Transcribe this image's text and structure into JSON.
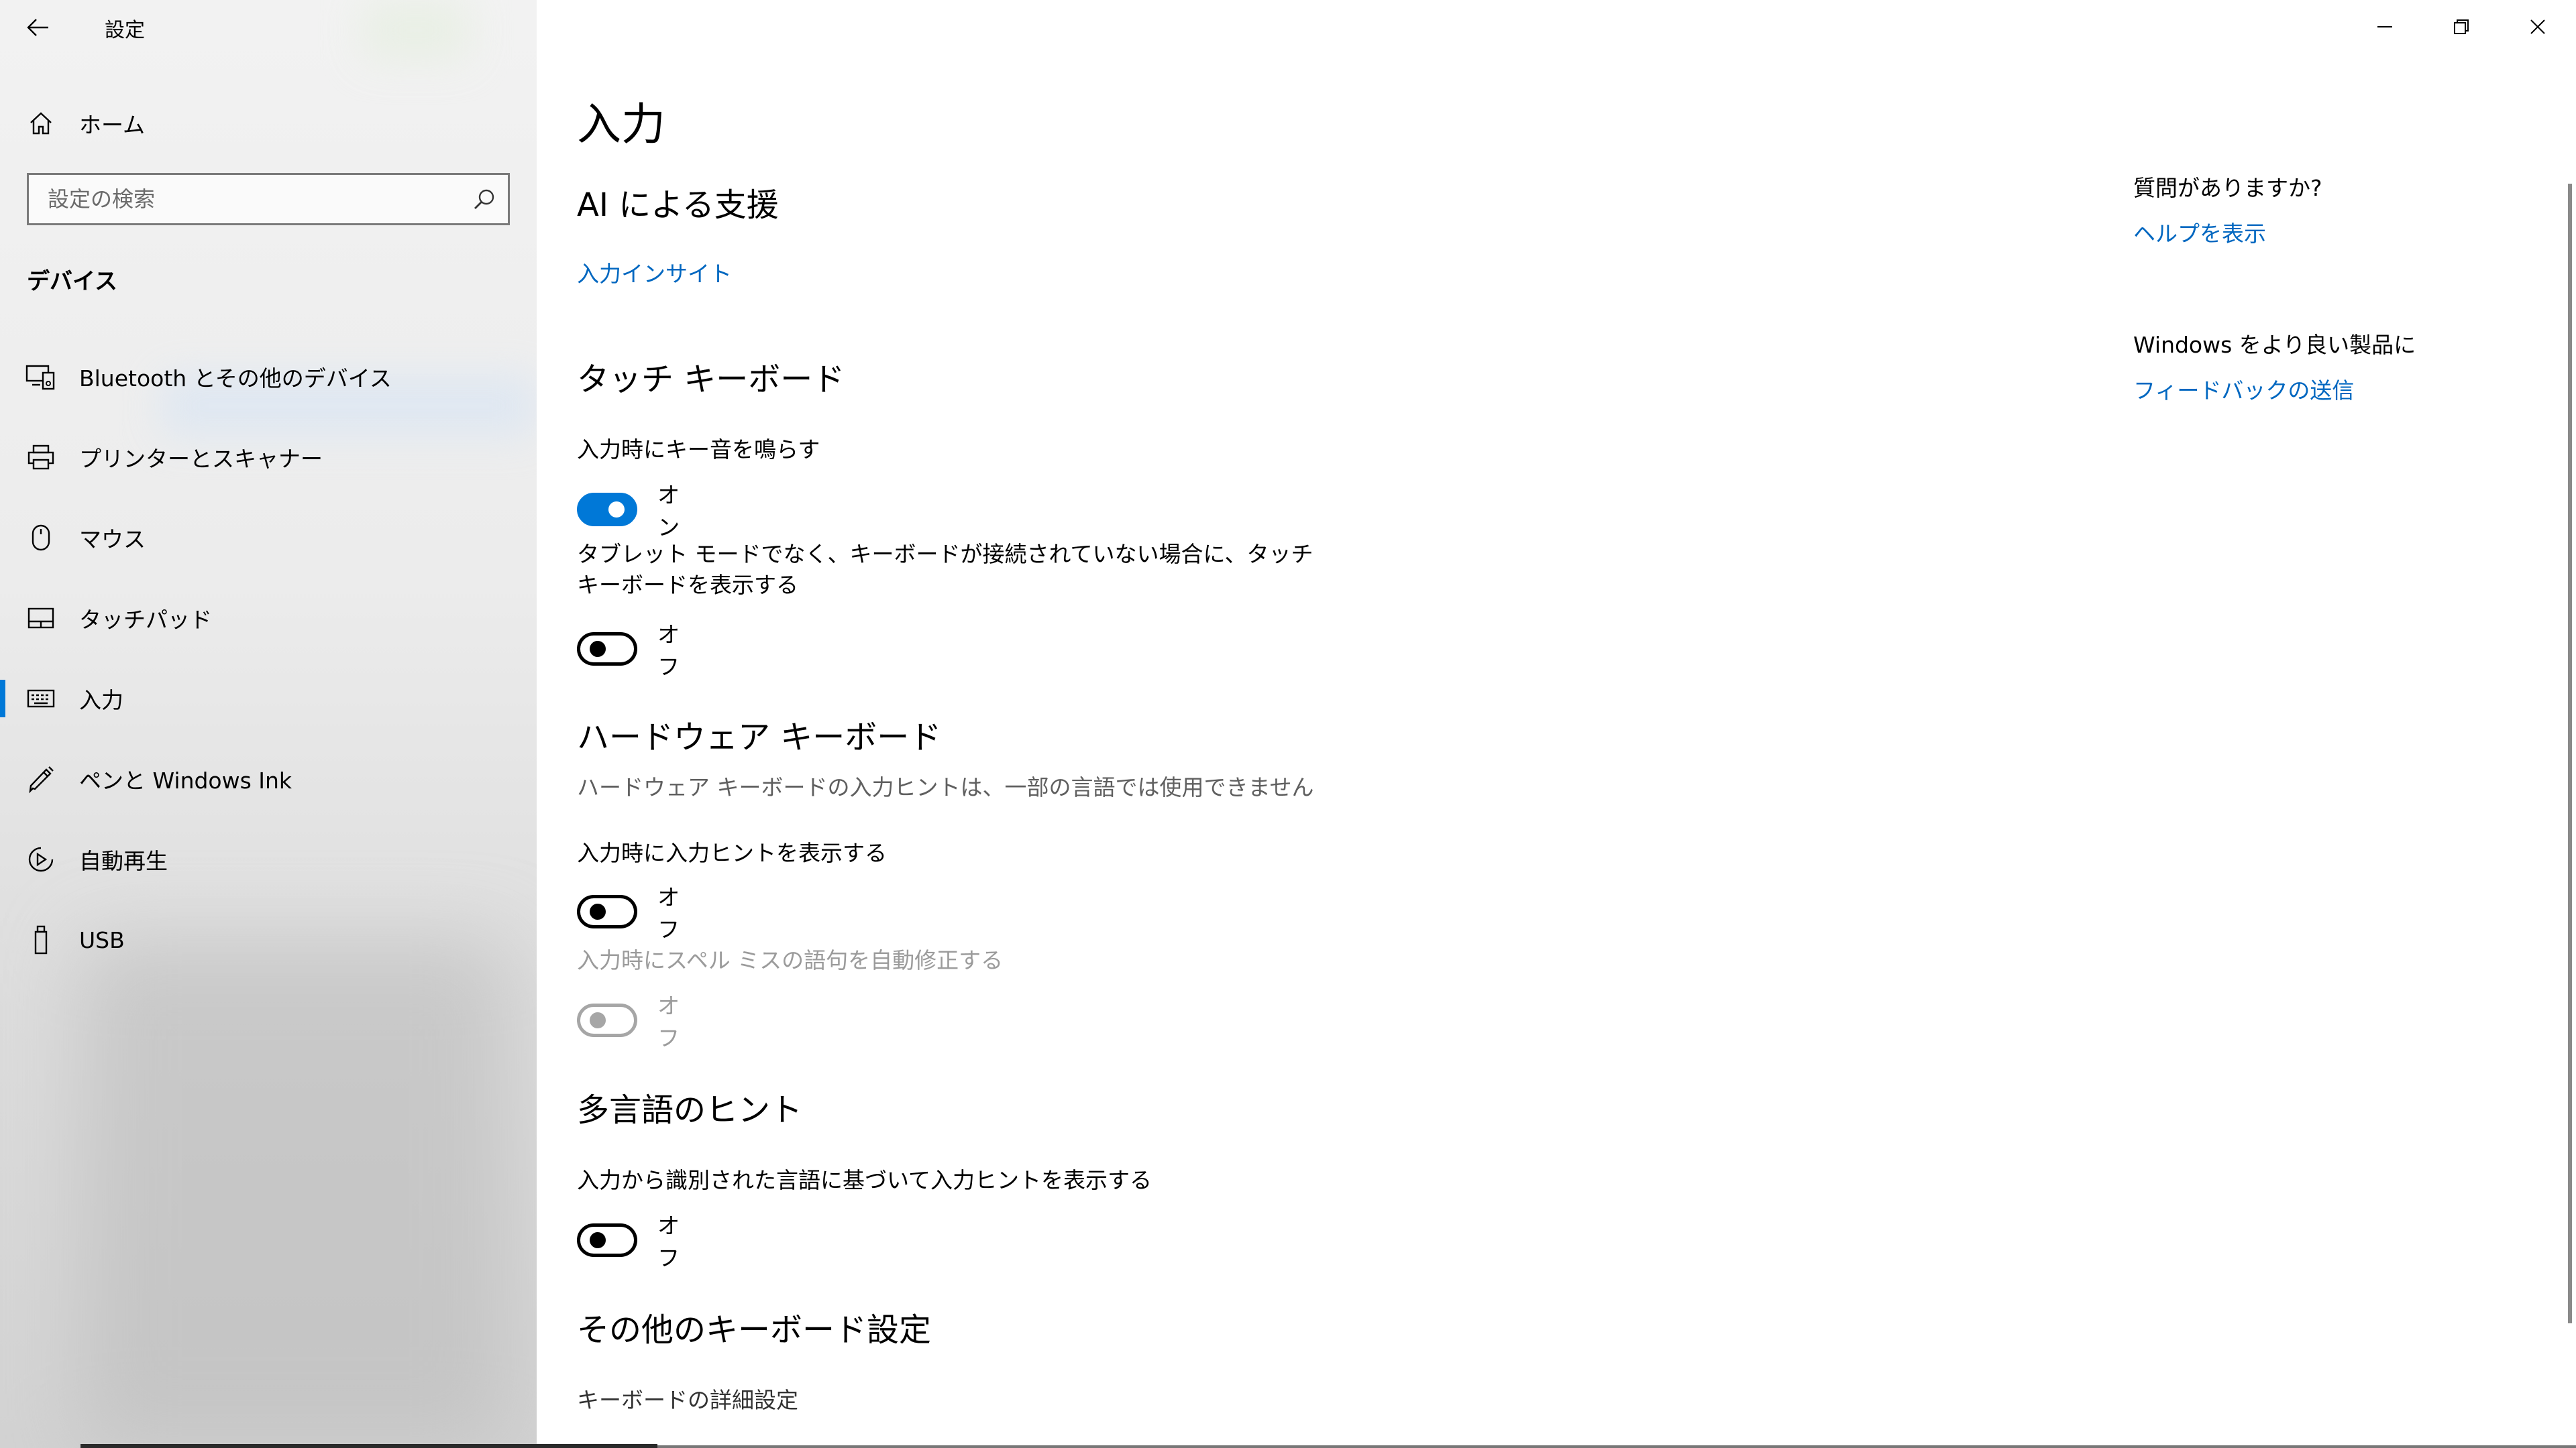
{
  "window": {
    "title": "設定",
    "controls": [
      "minimize",
      "restore",
      "close"
    ]
  },
  "sidebar": {
    "home_label": "ホーム",
    "search_placeholder": "設定の検索",
    "section": "デバイス",
    "items": [
      {
        "label": "Bluetooth とその他のデバイス",
        "icon": "devices-icon"
      },
      {
        "label": "プリンターとスキャナー",
        "icon": "printer-icon"
      },
      {
        "label": "マウス",
        "icon": "mouse-icon"
      },
      {
        "label": "タッチパッド",
        "icon": "touchpad-icon"
      },
      {
        "label": "入力",
        "icon": "keyboard-icon",
        "selected": true
      },
      {
        "label": "ペンと Windows Ink",
        "icon": "pen-icon"
      },
      {
        "label": "自動再生",
        "icon": "autoplay-icon"
      },
      {
        "label": "USB",
        "icon": "usb-icon"
      }
    ]
  },
  "main": {
    "title": "入力",
    "ai": {
      "title": "AI による支援",
      "link": "入力インサイト"
    },
    "touch": {
      "title": "タッチ キーボード",
      "sound_label": "入力時にキー音を鳴らす",
      "sound_state": "オン",
      "show_label": "タブレット モードでなく、キーボードが接続されていない場合に、タッチ キーボードを表示する",
      "show_state": "オフ"
    },
    "hardware": {
      "title": "ハードウェア キーボード",
      "desc": "ハードウェア キーボードの入力ヒントは、一部の言語では使用できません",
      "hint_label": "入力時に入力ヒントを表示する",
      "hint_state": "オフ",
      "autocorrect_label": "入力時にスペル ミスの語句を自動修正する",
      "autocorrect_state": "オフ"
    },
    "multilang": {
      "title": "多言語のヒント",
      "label": "入力から識別された言語に基づいて入力ヒントを表示する",
      "state": "オフ"
    },
    "other": {
      "title": "その他のキーボード設定",
      "link": "キーボードの詳細設定"
    }
  },
  "aside": {
    "question": "質問がありますか?",
    "help_link": "ヘルプを表示",
    "feedback_title": "Windows をより良い製品に",
    "feedback_link": "フィードバックの送信"
  },
  "colors": {
    "accent": "#0078d7",
    "link": "#0067c0",
    "sidebar_bg": "#ececec"
  }
}
